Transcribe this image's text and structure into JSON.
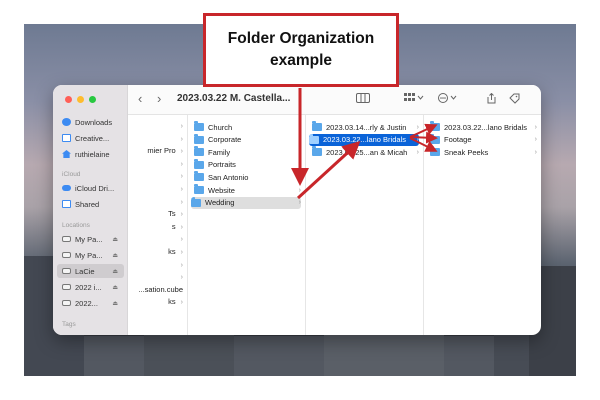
{
  "annotation": {
    "line1": "Folder Organization",
    "line2": "example",
    "color": "#c8262a"
  },
  "window": {
    "title": "2023.03.22 M. Castella...",
    "nav_back": "‹",
    "nav_forward": "›"
  },
  "toolbar": {
    "view_icon": "column-view-icon",
    "group_icon": "grid-group-icon",
    "more_icon": "ellipsis-icon",
    "share_icon": "share-icon",
    "tag_icon": "tag-icon",
    "dropbox_icon": "dropbox-icon",
    "search_icon": "search-icon"
  },
  "sidebar": {
    "favorites": [
      {
        "label": "Downloads",
        "icon": "download-icon"
      },
      {
        "label": "Creative...",
        "icon": "document-icon"
      },
      {
        "label": "ruthielaine",
        "icon": "home-icon"
      }
    ],
    "icloud_header": "iCloud",
    "icloud": [
      {
        "label": "iCloud Dri...",
        "icon": "cloud-icon"
      },
      {
        "label": "Shared",
        "icon": "shared-folder-icon"
      }
    ],
    "locations_header": "Locations",
    "locations": [
      {
        "label": "My Pa...",
        "icon": "drive-icon",
        "eject": "⏏"
      },
      {
        "label": "My Pa...",
        "icon": "drive-icon",
        "eject": "⏏"
      },
      {
        "label": "LaCie",
        "icon": "drive-icon",
        "eject": "⏏"
      },
      {
        "label": "2022 i...",
        "icon": "drive-icon",
        "eject": "⏏"
      },
      {
        "label": "2022...",
        "icon": "drive-icon",
        "eject": "⏏"
      }
    ],
    "tags_header": "Tags"
  },
  "column0_partial": [
    {
      "label": "",
      "chev": "›"
    },
    {
      "label": "",
      "chev": "›"
    },
    {
      "label": "mier Pro",
      "chev": "›"
    },
    {
      "label": "",
      "chev": "›"
    },
    {
      "label": "",
      "chev": "›"
    },
    {
      "label": "",
      "chev": "›"
    },
    {
      "label": "",
      "chev": "›"
    },
    {
      "label": "Ts",
      "chev": "›"
    },
    {
      "label": "s",
      "chev": "›"
    },
    {
      "label": "",
      "chev": "›"
    },
    {
      "label": "ks",
      "chev": "›"
    },
    {
      "label": "",
      "chev": "›"
    },
    {
      "label": "",
      "chev": "›"
    },
    {
      "label": "...sation.cube",
      "chev": ""
    },
    {
      "label": "ks",
      "chev": "›"
    }
  ],
  "column1": [
    {
      "label": "Church"
    },
    {
      "label": "Corporate"
    },
    {
      "label": "Family"
    },
    {
      "label": "Portraits"
    },
    {
      "label": "San Antonio"
    },
    {
      "label": "Website"
    },
    {
      "label": "Wedding"
    }
  ],
  "column2": [
    {
      "label": "2023.03.14...rly & Justin"
    },
    {
      "label": "2023.03.22...lano Bridals"
    },
    {
      "label": "2023.03.25...an & Micah"
    }
  ],
  "column3": [
    {
      "label": "2023.03.22...lano Bridals"
    },
    {
      "label": "Footage"
    },
    {
      "label": "Sneak Peeks"
    }
  ],
  "chevron": "›"
}
